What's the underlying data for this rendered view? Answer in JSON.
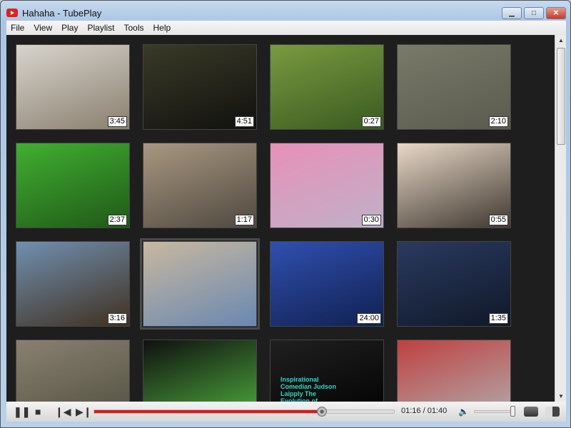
{
  "window": {
    "title": "Hahaha - TubePlay",
    "minimize": "▁",
    "maximize": "□",
    "close": "✕"
  },
  "menu": [
    "File",
    "View",
    "Play",
    "Playlist",
    "Tools",
    "Help"
  ],
  "videos": [
    {
      "duration": "3:45",
      "colors": [
        "#d8d4cc",
        "#8a7f70"
      ]
    },
    {
      "duration": "4:51",
      "colors": [
        "#3a3a28",
        "#11110e"
      ]
    },
    {
      "duration": "0:27",
      "colors": [
        "#7a9a40",
        "#3a5a20"
      ]
    },
    {
      "duration": "2:10",
      "colors": [
        "#7a7a6a",
        "#5a5a4e"
      ]
    },
    {
      "duration": "2:37",
      "colors": [
        "#40b030",
        "#205818"
      ]
    },
    {
      "duration": "1:17",
      "colors": [
        "#a89880",
        "#504840"
      ]
    },
    {
      "duration": "0:30",
      "colors": [
        "#e890b8",
        "#c0b0c8"
      ]
    },
    {
      "duration": "0:55",
      "colors": [
        "#e8d8c8",
        "#403830"
      ]
    },
    {
      "duration": "3:16",
      "colors": [
        "#7090b0",
        "#403020"
      ]
    },
    {
      "duration": "",
      "colors": [
        "#c8b8a0",
        "#6a88b0"
      ]
    },
    {
      "duration": "24:00",
      "colors": [
        "#3050b0",
        "#102050"
      ]
    },
    {
      "duration": "1:35",
      "colors": [
        "#2a3a60",
        "#101828"
      ]
    },
    {
      "duration": "",
      "colors": [
        "#8a8070",
        "#505040"
      ]
    },
    {
      "duration": "",
      "colors": [
        "#101010",
        "#50b040"
      ]
    },
    {
      "duration": "",
      "colors": [
        "#202020",
        "#000000"
      ]
    },
    {
      "duration": "",
      "colors": [
        "#c04040",
        "#b0b0b0"
      ]
    }
  ],
  "overlay_text": "Inspirational Comedian Judson Laipply The Evolution of Dance",
  "player": {
    "time": "01:16 / 01:40",
    "progress": 0.76,
    "volume": 1.0
  },
  "colors": {
    "accent": "#e01818"
  }
}
